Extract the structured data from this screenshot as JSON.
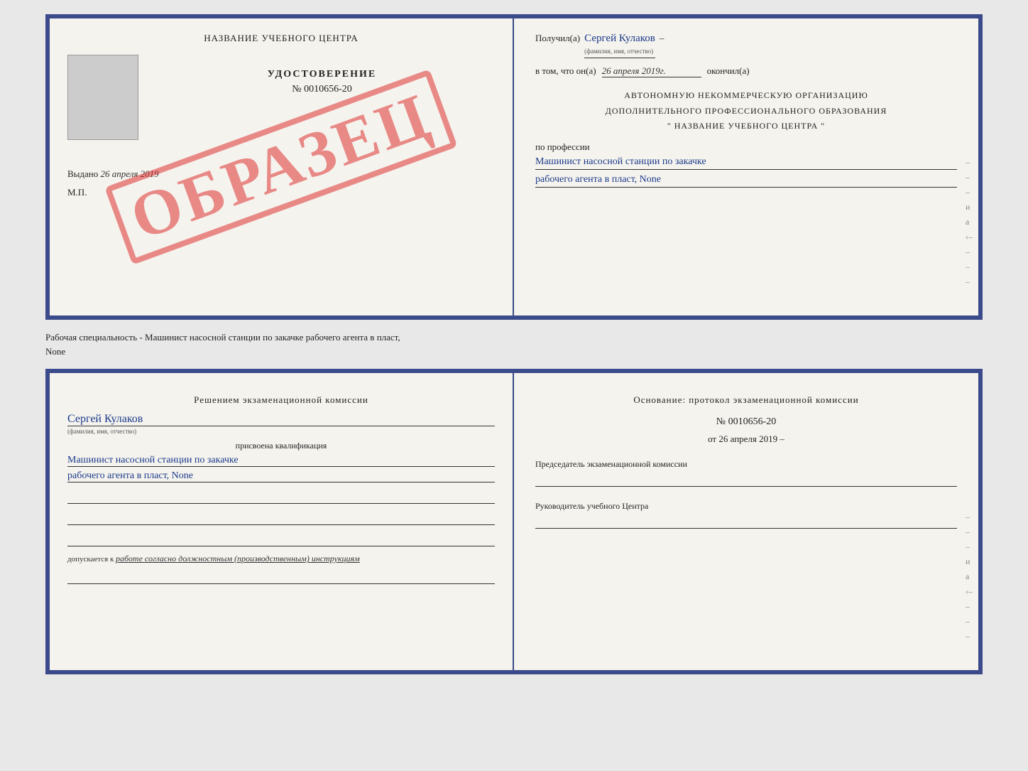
{
  "document": {
    "top": {
      "left": {
        "institution_title": "НАЗВАНИЕ УЧЕБНОГО ЦЕНТРА",
        "cert_label": "УДОСТОВЕРЕНИЕ",
        "cert_number": "№ 0010656-20",
        "issued_label": "Выдано",
        "issued_date": "26 апреля 2019",
        "mp_label": "М.П.",
        "watermark": "ОБРАЗЕЦ"
      },
      "right": {
        "received_label": "Получил(а)",
        "received_name": "Сергей Кулаков",
        "name_hint": "(фамилия, имя, отчество)",
        "date_prefix": "в том, что он(а)",
        "date_value": "26 апреля 2019г.",
        "date_suffix": "окончил(а)",
        "org_line1": "АВТОНОМНУЮ НЕКОММЕРЧЕСКУЮ ОРГАНИЗАЦИЮ",
        "org_line2": "ДОПОЛНИТЕЛЬНОГО ПРОФЕССИОНАЛЬНОГО ОБРАЗОВАНИЯ",
        "org_line3": "\" НАЗВАНИЕ УЧЕБНОГО ЦЕНТРА \"",
        "profession_label": "по профессии",
        "profession_line1": "Машинист насосной станции по закачке",
        "profession_line2": "рабочего агента в пласт, None"
      }
    },
    "separator": {
      "text": "Рабочая специальность - Машинист насосной станции по закачке рабочего агента в пласт,",
      "text2": "None"
    },
    "bottom": {
      "left": {
        "commission_text": "Решением экзаменационной комиссии",
        "person_name": "Сергей Кулаков",
        "name_hint": "(фамилия, имя, отчество)",
        "assigned_label": "присвоена квалификация",
        "qualification_line1": "Машинист насосной станции по закачке",
        "qualification_line2": "рабочего агента в пласт, None",
        "allowed_prefix": "допускается к",
        "allowed_italic": "работе согласно должностным (производственным) инструкциям"
      },
      "right": {
        "ground_label": "Основание: протокол экзаменационной комиссии",
        "protocol_number": "№ 0010656-20",
        "protocol_date_prefix": "от",
        "protocol_date": "26 апреля 2019",
        "chairman_label": "Председатель экзаменационной комиссии",
        "director_label": "Руководитель учебного Центра"
      }
    }
  },
  "side_marks": {
    "marks": [
      "–",
      "–",
      "–",
      "и",
      "а",
      "‹–"
    ]
  }
}
